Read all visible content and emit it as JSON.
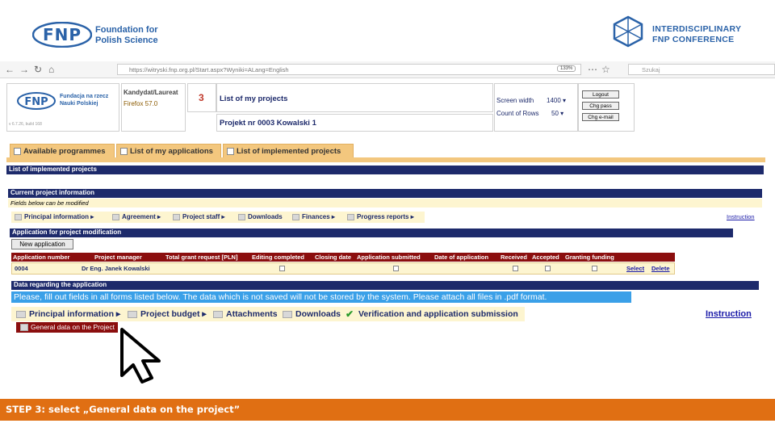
{
  "slide": {
    "fnp_mark": "FNP",
    "fnp_name_line1": "Foundation for",
    "fnp_name_line2": "Polish Science",
    "conference_line1": "INTERDISCIPLINARY",
    "conference_line2": "FNP CONFERENCE",
    "footer_text": "STEP 3: select „General data on the project”"
  },
  "browser": {
    "url": "https://witryski.fnp.org.pl/Start.aspx?Wyniki=ALang=English",
    "zoom": "133%",
    "search_placeholder": "Szukaj"
  },
  "app_header": {
    "logo_mark": "FNP",
    "logo_line1": "Fundacja na rzecz",
    "logo_line2": "Nauki Polskiej",
    "version": "v 6.7.26, build 168",
    "role": "Kandydat/Laureat",
    "browser_name": "Firefox 57.0",
    "page_number": "3",
    "page_title": "List of my projects",
    "project_title": "Projekt nr 0003 Kowalski 1",
    "screen_width_label": "Screen width",
    "screen_width_value": "1400",
    "rows_label": "Count of Rows",
    "rows_value": "50",
    "logout_label": "Logout",
    "chg_pass_label": "Chg pass",
    "chg_mail_label": "Chg e-mail"
  },
  "tabs": [
    {
      "label": "Available programmes"
    },
    {
      "label": "List of my applications"
    },
    {
      "label": "List of implemented projects"
    }
  ],
  "sections": {
    "implemented_title": "List of implemented projects",
    "current_info_title": "Current project information",
    "fields_note": "Fields below can be modified",
    "modification_title": "Application for project modification",
    "new_application_label": "New application",
    "data_regarding_title": "Data regarding the application",
    "fill_notice": "Please, fill out fields in all forms listed below. The data which is not saved will not be stored by the system. Please attach all files in .pdf format.",
    "instruction_small": "Instruction",
    "instruction_large": "Instruction"
  },
  "menu1": [
    {
      "label": "Principal information"
    },
    {
      "label": "Agreement"
    },
    {
      "label": "Project staff"
    },
    {
      "label": "Downloads"
    },
    {
      "label": "Finances"
    },
    {
      "label": "Progress reports"
    }
  ],
  "table": {
    "headers": [
      "Application number",
      "Project manager",
      "Total grant request [PLN]",
      "Editing completed",
      "Closing date",
      "Application submitted",
      "Date of application",
      "Received",
      "Accepted",
      "Granting funding"
    ],
    "row": {
      "number": "0004",
      "manager": "Dr Eng. Janek Kowalski",
      "select_label": "Select",
      "delete_label": "Delete"
    }
  },
  "menu2": [
    {
      "label": "Principal information"
    },
    {
      "label": "Project budget"
    },
    {
      "label": "Attachments"
    },
    {
      "label": "Downloads"
    },
    {
      "label": "Verification and application submission"
    }
  ],
  "submenu": {
    "general_data_label": "General data on the Project"
  },
  "colors": {
    "brand_blue": "#2a62a8",
    "navy": "#1d2a6b",
    "header_red": "#8b0e0e",
    "tab_orange": "#f3c77e",
    "footer_orange": "#e06f13",
    "highlight_blue": "#3aa0e8"
  }
}
